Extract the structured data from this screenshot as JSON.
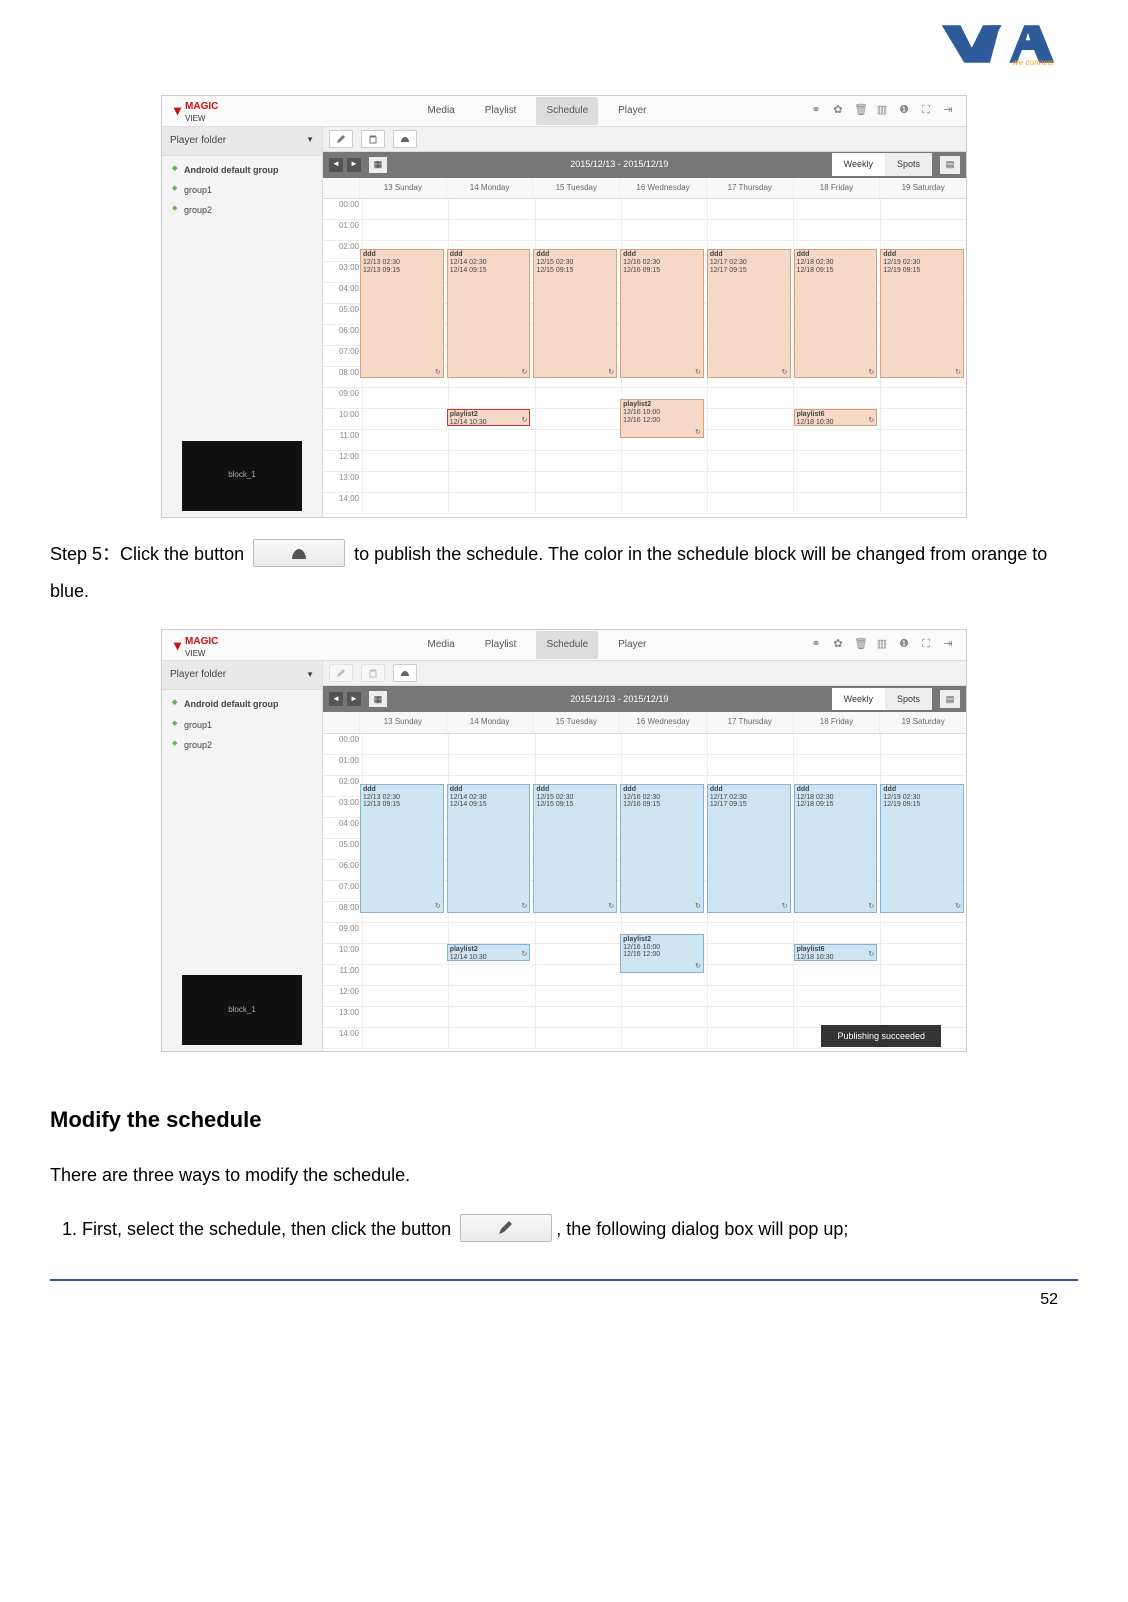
{
  "logo_tagline": "we connect",
  "step5_pre": "Step 5：Click the button",
  "step5_post": " to publish the schedule. The color in the schedule block will be changed from orange to blue.",
  "section_heading": "Modify the schedule",
  "modify_intro": "There are three ways to modify the schedule.",
  "modify_item1_pre": "First, select the schedule, then click the button",
  "modify_item1_post": ", the following dialog box will pop up;",
  "page_number": "52",
  "shot": {
    "brand_top": "MAGIC",
    "brand_bottom": "VIEW",
    "nav": {
      "media": "Media",
      "playlist": "Playlist",
      "schedule": "Schedule",
      "player": "Player"
    },
    "side_title": "Player folder",
    "tree": {
      "g0": "Android default group",
      "g1": "group1",
      "g2": "group2"
    },
    "thumb_label": "block_1",
    "date_range": "2015/12/13 - 2015/12/19",
    "view_weekly": "Weekly",
    "view_spots": "Spots",
    "days": [
      "13 Sunday",
      "14 Monday",
      "15 Tuesday",
      "16 Wednesday",
      "17 Thursday",
      "18 Friday",
      "19 Saturday"
    ],
    "hours": [
      "00:00",
      "01:00",
      "02:00",
      "03:00",
      "04:00",
      "05:00",
      "06:00",
      "07:00",
      "08:00",
      "09:00",
      "10:00",
      "11:00",
      "12:00",
      "13:00",
      "14:00"
    ],
    "ev_ddd": {
      "title": "ddd",
      "t": [
        "12/13 02:30",
        "12/14 02:30",
        "12/15 02:30",
        "12/16 02:30",
        "12/17 02:30",
        "12/18 02:30",
        "12/19 02:30"
      ],
      "b": [
        "12/13 09:15",
        "12/14 09:15",
        "12/15 09:15",
        "12/16 09:15",
        "12/17 09:15",
        "12/18 09:15",
        "12/19 09:15"
      ]
    },
    "ev_pl": {
      "p2a": {
        "title": "playlist2",
        "t": "12/14 10:30"
      },
      "p2b": {
        "title": "playlist2",
        "t": "12/16 10:00",
        "b": "12/16 12:00"
      },
      "p6": {
        "title": "playlist6",
        "t": "12/18 10:30"
      }
    },
    "toast": "Publishing succeeded"
  }
}
